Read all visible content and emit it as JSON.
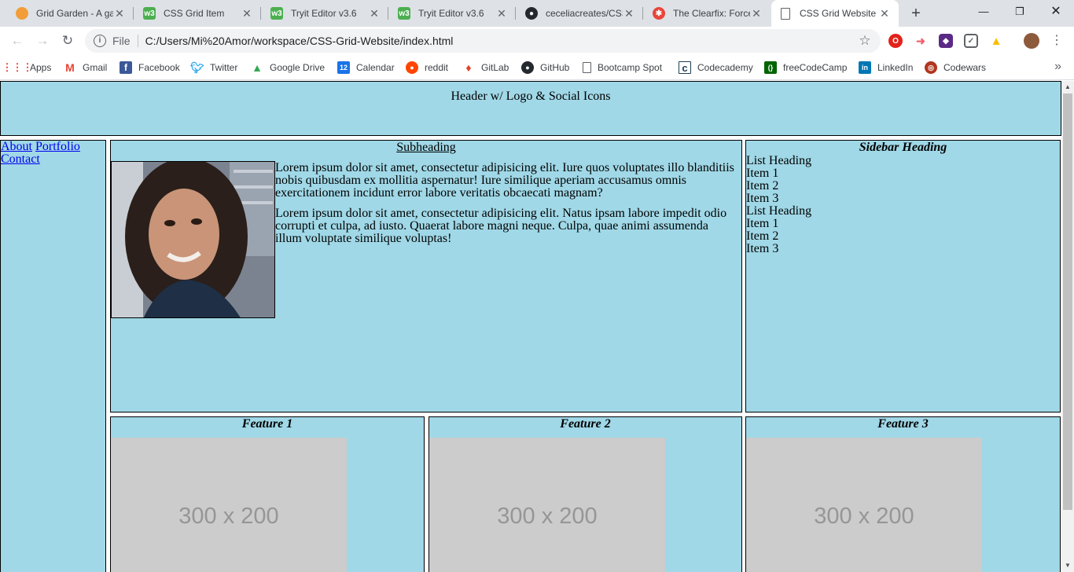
{
  "browser": {
    "tabs": [
      {
        "title": "Grid Garden - A game for learning CSS grid",
        "icon": "carrot-icon",
        "active": false
      },
      {
        "title": "CSS Grid Item",
        "icon": "w3schools-icon",
        "active": false
      },
      {
        "title": "Tryit Editor v3.6",
        "icon": "w3schools-icon",
        "active": false
      },
      {
        "title": "Tryit Editor v3.6",
        "icon": "w3schools-icon",
        "active": false
      },
      {
        "title": "ceceliacreates/CSS-Grid-Website",
        "icon": "github-icon",
        "active": false
      },
      {
        "title": "The Clearfix: Force an Element",
        "icon": "css-tricks-icon",
        "active": false
      },
      {
        "title": "CSS Grid Website",
        "icon": "document-icon",
        "active": true
      }
    ],
    "address": {
      "scheme": "File",
      "url": "C:/Users/Mi%20Amor/workspace/CSS-Grid-Website/index.html"
    },
    "bookmarks": [
      {
        "label": "Apps",
        "icon": "apps-grid-icon"
      },
      {
        "label": "Gmail",
        "icon": "gmail-icon"
      },
      {
        "label": "Facebook",
        "icon": "facebook-icon"
      },
      {
        "label": "Twitter",
        "icon": "twitter-icon"
      },
      {
        "label": "Google Drive",
        "icon": "google-drive-icon"
      },
      {
        "label": "Calendar",
        "icon": "calendar-icon"
      },
      {
        "label": "reddit",
        "icon": "reddit-icon"
      },
      {
        "label": "GitLab",
        "icon": "gitlab-icon"
      },
      {
        "label": "GitHub",
        "icon": "github-icon"
      },
      {
        "label": "Bootcamp Spot",
        "icon": "document-icon"
      },
      {
        "label": "Codecademy",
        "icon": "codecademy-icon"
      },
      {
        "label": "freeCodeCamp",
        "icon": "freecodecamp-icon"
      },
      {
        "label": "LinkedIn",
        "icon": "linkedin-icon"
      },
      {
        "label": "Codewars",
        "icon": "codewars-icon"
      }
    ],
    "calendar_day": "12"
  },
  "page": {
    "header": "Header w/ Logo & Social Icons",
    "nav": [
      "About",
      "Portfolio",
      "Contact"
    ],
    "main": {
      "subheading": "Subheading",
      "paragraphs": [
        "Lorem ipsum dolor sit amet, consectetur adipisicing elit. Iure quos voluptates illo blanditiis nobis quibusdam ex mollitia aspernatur! Iure similique aperiam accusamus omnis exercitationem incidunt error labore veritatis obcaecati magnam?",
        "Lorem ipsum dolor sit amet, consectetur adipisicing elit. Natus ipsam labore impedit odio corrupti et culpa, ad iusto. Quaerat labore magni neque. Culpa, quae animi assumenda illum voluptate similique voluptas!"
      ]
    },
    "sidebar": {
      "heading": "Sidebar Heading",
      "items": [
        "List Heading",
        "Item 1",
        "Item 2",
        "Item 3",
        "List Heading",
        "Item 1",
        "Item 2",
        "Item 3"
      ]
    },
    "features": [
      {
        "title": "Feature 1",
        "image_text": "300 x 200"
      },
      {
        "title": "Feature 2",
        "image_text": "300 x 200"
      },
      {
        "title": "Feature 3",
        "image_text": "300 x 200"
      }
    ]
  },
  "colors": {
    "page_background": "#a0d8e7",
    "placeholder_bg": "#cccccc",
    "placeholder_text": "#969696",
    "link": "#0000ee"
  }
}
